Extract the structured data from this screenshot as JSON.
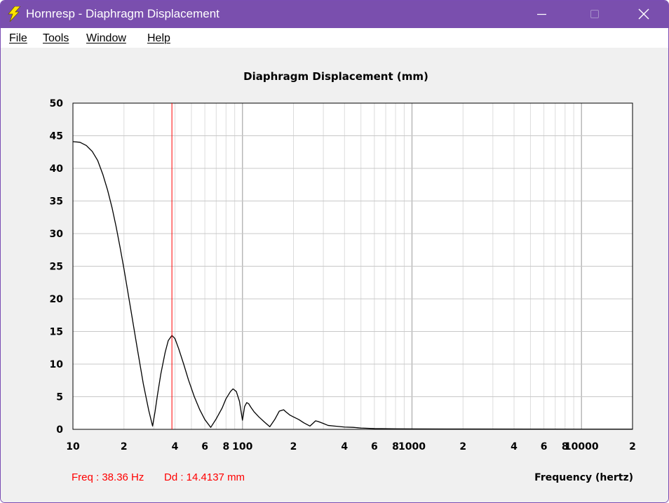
{
  "window": {
    "title": "Hornresp - Diaphragm Displacement",
    "accent_color": "#7a4fae",
    "icon": "lightning-bolt-icon",
    "controls": [
      "minimize-icon",
      "maximize-icon",
      "close-icon"
    ]
  },
  "menu": {
    "file": "File",
    "tools": "Tools",
    "window": "Window",
    "help": "Help"
  },
  "readout": {
    "freq": "Freq : 38.36 Hz",
    "dd": "Dd : 14.4137 mm",
    "color": "#ff0000"
  },
  "chart_data": {
    "type": "line",
    "title": "Diaphragm Displacement (mm)",
    "xlabel": "Frequency (hertz)",
    "ylabel": "",
    "x_scale": "log",
    "xlim": [
      10,
      20000
    ],
    "ylim": [
      0,
      50
    ],
    "grid": true,
    "y_ticks": [
      0,
      5,
      10,
      15,
      20,
      25,
      30,
      35,
      40,
      45,
      50
    ],
    "x_tick_labels": [
      {
        "value": 10,
        "label": "10"
      },
      {
        "value": 20,
        "label": "2"
      },
      {
        "value": 40,
        "label": "4"
      },
      {
        "value": 60,
        "label": "6"
      },
      {
        "value": 80,
        "label": "8"
      },
      {
        "value": 100,
        "label": "100"
      },
      {
        "value": 200,
        "label": "2"
      },
      {
        "value": 400,
        "label": "4"
      },
      {
        "value": 600,
        "label": "6"
      },
      {
        "value": 800,
        "label": "8"
      },
      {
        "value": 1000,
        "label": "1000"
      },
      {
        "value": 2000,
        "label": "2"
      },
      {
        "value": 4000,
        "label": "4"
      },
      {
        "value": 6000,
        "label": "6"
      },
      {
        "value": 8000,
        "label": "8"
      },
      {
        "value": 10000,
        "label": "10000"
      },
      {
        "value": 20000,
        "label": "2"
      }
    ],
    "cursor_x": 38.36,
    "cursor_color": "#ff0000",
    "line_color": "#000000",
    "series": [
      {
        "x": [
          10,
          11,
          12,
          13,
          14,
          15,
          16,
          17,
          18,
          19,
          20,
          22,
          24,
          26,
          28,
          29.5,
          30.5,
          31.5,
          33,
          35,
          36.5,
          38.36,
          40,
          42,
          45,
          48,
          52,
          56,
          60,
          65,
          70,
          76,
          80,
          85,
          88,
          92,
          96,
          100,
          103,
          106,
          109,
          112,
          117,
          125,
          135,
          145,
          155,
          165,
          175,
          180,
          190,
          200,
          215,
          230,
          250,
          260,
          270,
          280,
          300,
          320,
          350,
          400,
          450,
          500,
          600,
          800,
          1000,
          2000,
          5000,
          10000,
          20000
        ],
        "y": [
          44.1,
          44.0,
          43.5,
          42.6,
          41.2,
          39.1,
          36.7,
          34.0,
          31.0,
          27.8,
          24.6,
          18.2,
          12.3,
          7.0,
          2.9,
          0.5,
          2.7,
          5.2,
          8.5,
          11.8,
          13.6,
          14.4,
          13.9,
          12.4,
          10.0,
          7.6,
          5.0,
          3.0,
          1.5,
          0.3,
          1.6,
          3.3,
          4.7,
          5.8,
          6.2,
          5.8,
          4.3,
          1.4,
          3.5,
          4.1,
          3.9,
          3.4,
          2.7,
          1.9,
          1.1,
          0.4,
          1.5,
          2.8,
          3.0,
          2.7,
          2.2,
          1.9,
          1.5,
          1.0,
          0.5,
          0.9,
          1.3,
          1.2,
          0.9,
          0.6,
          0.5,
          0.35,
          0.3,
          0.2,
          0.12,
          0.08,
          0.06,
          0.05,
          0.04,
          0.03,
          0.03
        ]
      }
    ]
  }
}
